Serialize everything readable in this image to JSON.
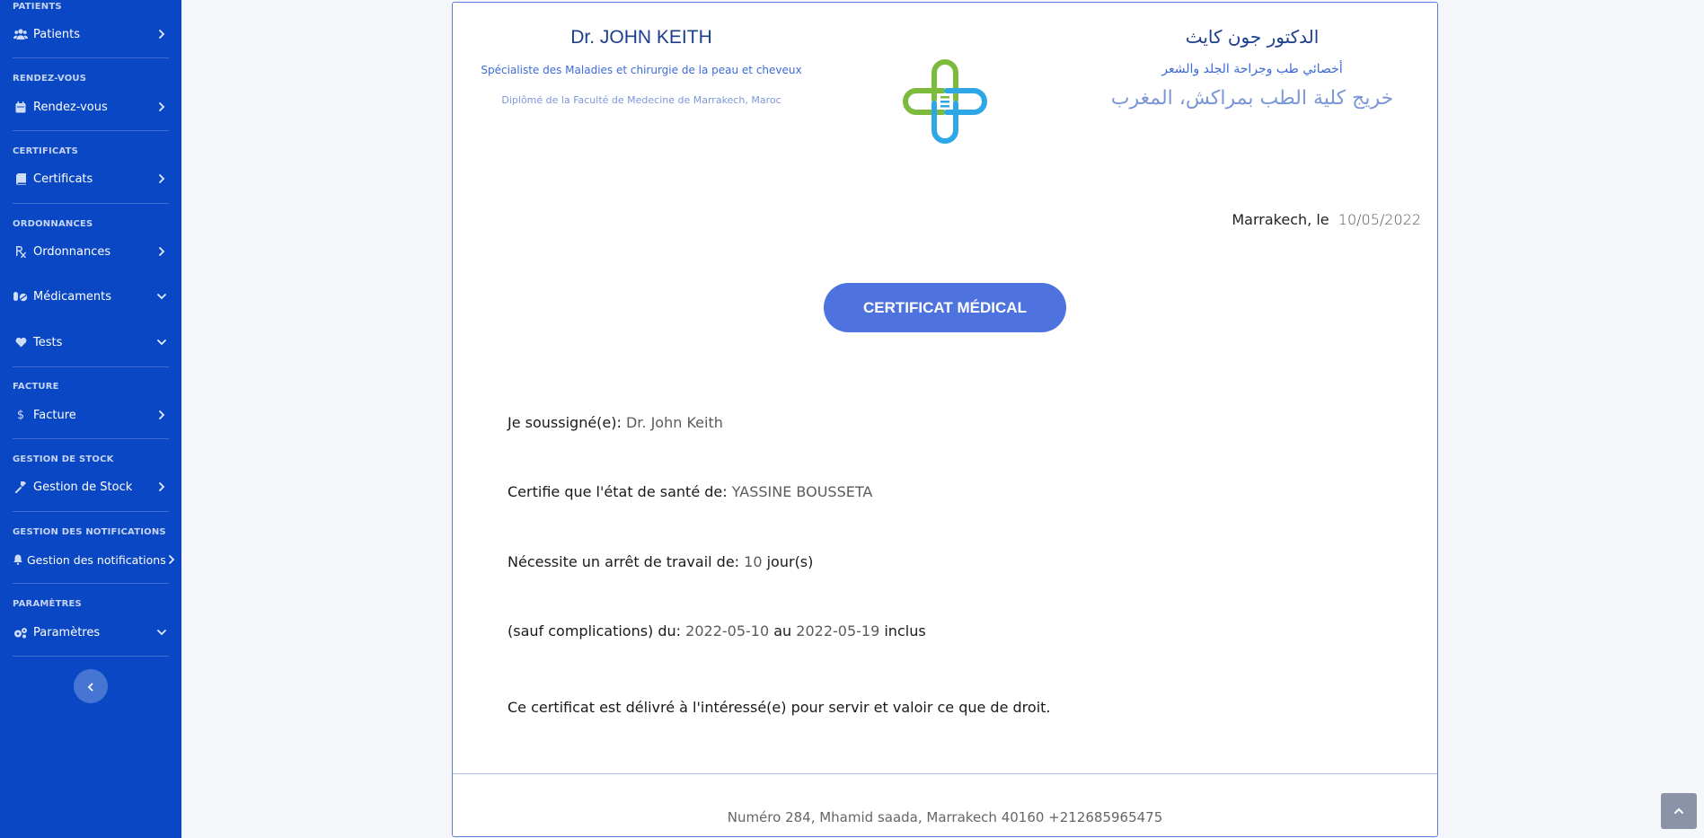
{
  "sidebar": {
    "sections": {
      "patients": "PATIENTS",
      "rdv": "RENDEZ-VOUS",
      "certificats": "CERTIFICATS",
      "ordonnances": "ORDONNANCES",
      "facture": "FACTURE",
      "stock": "GESTION DE STOCK",
      "notifications": "GESTION DES NOTIFICATIONS",
      "parametres": "PARAMÈTRES"
    },
    "items": {
      "patients": "Patients",
      "rdv": "Rendez-vous",
      "certificats": "Certificats",
      "ordonnances": "Ordonnances",
      "medicaments": "Médicaments",
      "tests": "Tests",
      "facture": "Facture",
      "stock": "Gestion de Stock",
      "notifications": "Gestion des notifications",
      "parametres": "Paramètres"
    }
  },
  "doctor": {
    "name": "Dr. JOHN KEITH",
    "specialty": "Spécialiste des Maladies et chirurgie de la peau et cheveux",
    "diploma": "Diplômé de la Faculté de Medecine de Marrakech, Maroc",
    "name_ar": "الدكتور جون كايث",
    "specialty_ar": "أخصائي طب وجراحة الجلد والشعر",
    "diploma_ar": "خريج كلية الطب بمراكش، المغرب"
  },
  "certificate": {
    "place_label": "Marrakech, le",
    "date": "10/05/2022",
    "title": "CERTIFICAT MÉDICAL",
    "undersigned_label": "Je soussigné(e):",
    "undersigned": "Dr. John Keith",
    "health_label": "Certifie que l'état de santé de:",
    "patient": "YASSINE BOUSSETA",
    "stop_label": "Nécessite un arrêt de travail de:",
    "days": "10",
    "days_unit": "jour(s)",
    "period_label": "(sauf complications) du:",
    "from": "2022-05-10",
    "to_label": "au",
    "to": "2022-05-19",
    "inclusive": "inclus",
    "closing": "Ce certificat est délivré à l'intéressé(e) pour servir et valoir ce que de droit."
  },
  "footer": {
    "address": "Numéro 284, Mhamid saada, Marrakech 40160 +212685965475"
  },
  "colors": {
    "sidebar": "#0a47c4",
    "accent": "#4e73df",
    "logo_green": "#7dbb3c",
    "logo_blue": "#2ea7e6"
  }
}
